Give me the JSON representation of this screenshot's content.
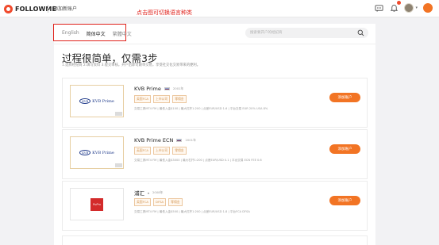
{
  "header": {
    "logo_text": "FOLLOWME",
    "title": "添加新账户",
    "annotation": "点击图可切换语言种类",
    "icons": [
      "chat-icon",
      "bell-icon",
      "avatar",
      "settings-icon"
    ]
  },
  "language_tabs": [
    {
      "label": "English",
      "active": false
    },
    {
      "label": "简体中文",
      "active": true
    },
    {
      "label": "繁體中文",
      "active": false
    }
  ],
  "search": {
    "placeholder": "搜索要开户的经纪商"
  },
  "page": {
    "heading": "过程很简单，仅需3步",
    "subtext": "1.选择经纪商  2.填写资料  3.提交审核。开户后即可跟单交易，享受社交化交易带来的便利。"
  },
  "brokers": [
    {
      "name": "KVB Prime",
      "year": "2001年",
      "logo_text": "KVB Prime",
      "tags": [
        "英国FCA",
        "上市公司",
        "零佣金"
      ],
      "info": "交易工具MT4 FM  |  最低入金$100  |  最大杠杆1:200  |  点差EUR/USD 1.6  |  平台交易 EUR 20%  USA 8%",
      "button": "添加账户"
    },
    {
      "name": "KVB Prime ECN",
      "year": "2001年",
      "logo_text": "KVB Prime",
      "tags": [
        "英国FCA",
        "上市公司",
        "零佣金"
      ],
      "info": "交易工具MT4 FM  |  最低入金$3000  |  最大杠杆1:200  |  点差EUR/USD 0.1  |  平台交易 ECN  FEE 0.6",
      "button": "添加账户"
    },
    {
      "name": "浦汇",
      "year": "2008年",
      "logo_text": "PuPro",
      "tags": [
        "英国FCA",
        "DFSA",
        "零佣金"
      ],
      "info": "交易工具MT4 FM  |  最低入金$500  |  最大杠杆1:200  |  点差EUR/USD 1.8  |  平台FCA  DFSA",
      "button": "添加账户"
    }
  ],
  "colors": {
    "accent": "#f27424",
    "annotation": "#e0221b",
    "tag": "#d39654"
  }
}
